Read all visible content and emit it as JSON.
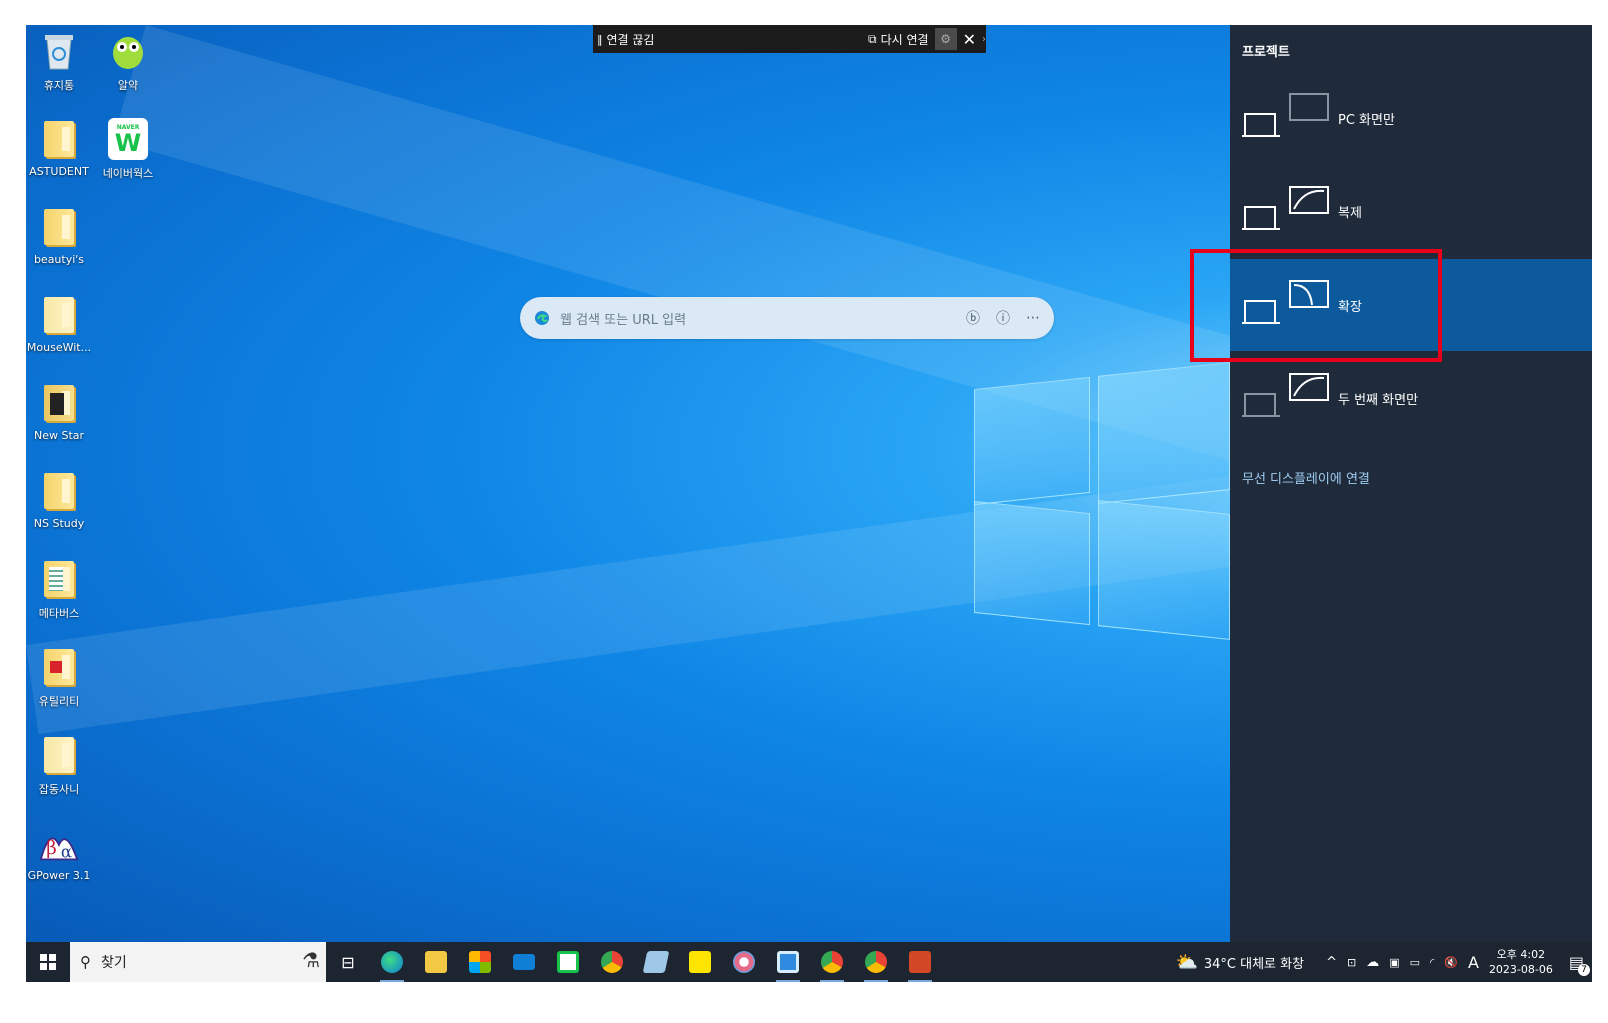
{
  "desktop": {
    "icons": [
      {
        "label": "휴지통",
        "icon": "recycle-bin-icon"
      },
      {
        "label": "알약",
        "icon": "alyac-icon"
      },
      {
        "label": "ASTUDENT",
        "icon": "folder-icon"
      },
      {
        "label": "네이버웍스",
        "icon": "naver-works-icon"
      },
      {
        "label": "beautyi's",
        "icon": "folder-icon"
      },
      {
        "label": "MouseWit...",
        "icon": "folder-icon"
      },
      {
        "label": "New Star",
        "icon": "app-icon"
      },
      {
        "label": "NS Study",
        "icon": "folder-icon"
      },
      {
        "label": "메타버스",
        "icon": "folder-icon"
      },
      {
        "label": "유틸리티",
        "icon": "folder-icon"
      },
      {
        "label": "잡동사니",
        "icon": "folder-icon"
      },
      {
        "label": "GPower 3.1",
        "icon": "gpower-icon"
      }
    ],
    "naver_badge": "NAVER"
  },
  "rdp_bar": {
    "disconnect": "연결 끊김",
    "reconnect": "다시 연결"
  },
  "edge_search": {
    "placeholder": "웹 검색 또는 URL 입력"
  },
  "project_panel": {
    "title": "프로젝트",
    "options": [
      {
        "label": "PC 화면만",
        "selected": false
      },
      {
        "label": "복제",
        "selected": false
      },
      {
        "label": "확장",
        "selected": true
      },
      {
        "label": "두 번째 화면만",
        "selected": false
      }
    ],
    "wireless": "무선 디스플레이에 연결",
    "highlight_color": "#e8001a",
    "selected_color": "#0c5a9c"
  },
  "taskbar": {
    "search_label": "찾기",
    "weather": "34°C 대체로 화창",
    "ime": "A",
    "time": "오후 4:02",
    "date": "2023-08-06",
    "notification_count": "7"
  }
}
